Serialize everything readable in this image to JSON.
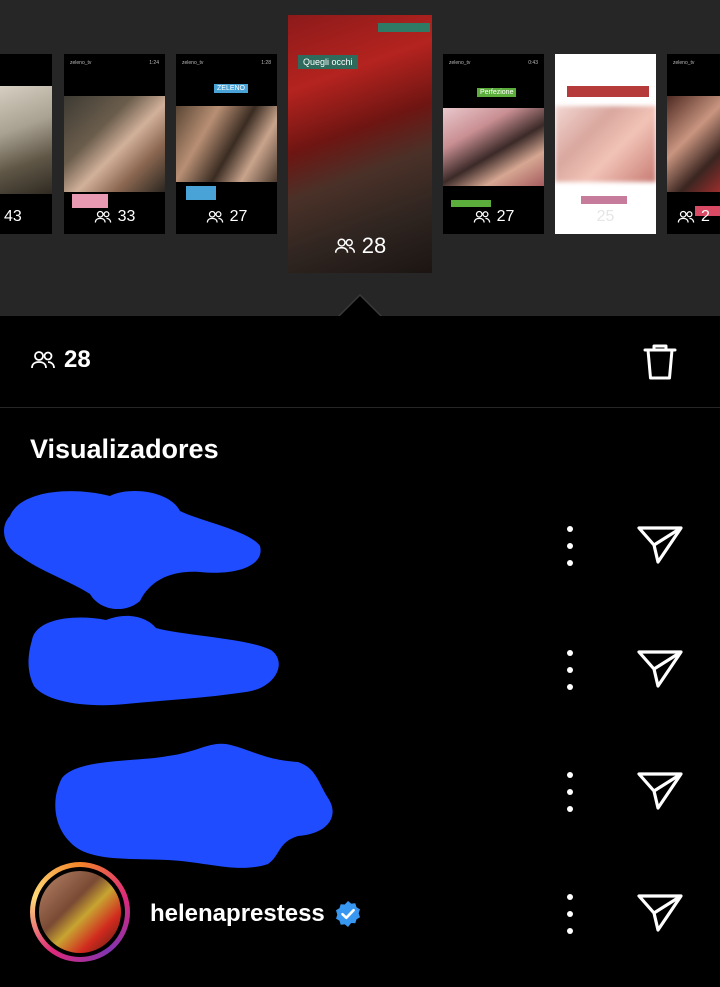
{
  "stories": [
    {
      "count": "43"
    },
    {
      "count": "33",
      "meta_left": "zeleno_tv",
      "meta_right": "1:24"
    },
    {
      "count": "27",
      "meta_left": "zeleno_tv",
      "meta_right": "1:28",
      "tag": "ZELENO"
    },
    {
      "count": "28",
      "caption": "Quegli occhi"
    },
    {
      "count": "27",
      "meta_left": "zeleno_tv",
      "meta_right": "0:43",
      "tag": "Perfezione"
    },
    {
      "count": "25"
    },
    {
      "count": "2",
      "meta_left": "zeleno_tv"
    }
  ],
  "summary": {
    "viewer_count": "28"
  },
  "viewers_section": {
    "title": "Visualizadores"
  },
  "viewers": [
    {
      "username": ""
    },
    {
      "username": ""
    },
    {
      "username": ""
    },
    {
      "username": "helenaprestess",
      "verified": true
    }
  ],
  "colors": {
    "top_strip_bg": "#262626",
    "redaction_blue": "#1f4cff",
    "verified_blue": "#3897f0"
  },
  "icons": [
    "people-icon",
    "trash-icon",
    "more-vertical-icon",
    "send-icon",
    "verified-badge-icon"
  ]
}
